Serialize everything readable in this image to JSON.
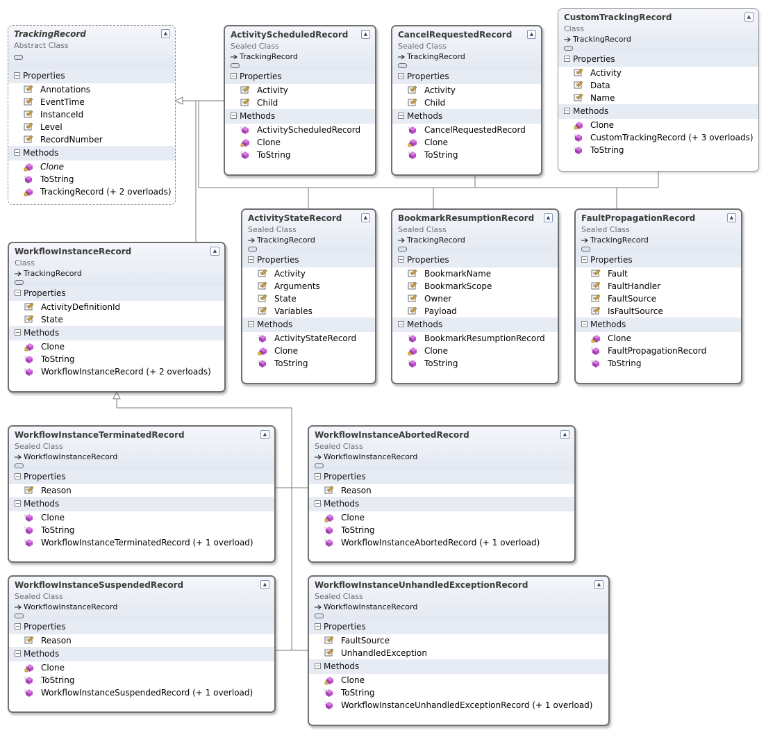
{
  "classes": {
    "tracking_record": {
      "name": "TrackingRecord",
      "stereotype": "Abstract Class",
      "base": "",
      "properties_label": "Properties",
      "methods_label": "Methods",
      "properties": [
        "Annotations",
        "EventTime",
        "InstanceId",
        "Level",
        "RecordNumber"
      ],
      "methods": [
        "Clone",
        "ToString",
        "TrackingRecord (+ 2 overloads)"
      ]
    },
    "activity_scheduled": {
      "name": "ActivityScheduledRecord",
      "stereotype": "Sealed Class",
      "base": "TrackingRecord",
      "properties_label": "Properties",
      "methods_label": "Methods",
      "properties": [
        "Activity",
        "Child"
      ],
      "methods": [
        "ActivityScheduledRecord",
        "Clone",
        "ToString"
      ]
    },
    "cancel_requested": {
      "name": "CancelRequestedRecord",
      "stereotype": "Sealed Class",
      "base": "TrackingRecord",
      "properties_label": "Properties",
      "methods_label": "Methods",
      "properties": [
        "Activity",
        "Child"
      ],
      "methods": [
        "CancelRequestedRecord",
        "Clone",
        "ToString"
      ]
    },
    "custom_tracking": {
      "name": "CustomTrackingRecord",
      "stereotype": "Class",
      "base": "TrackingRecord",
      "properties_label": "Properties",
      "methods_label": "Methods",
      "properties": [
        "Activity",
        "Data",
        "Name"
      ],
      "methods": [
        "Clone",
        "CustomTrackingRecord (+ 3 overloads)",
        "ToString"
      ]
    },
    "workflow_instance": {
      "name": "WorkflowInstanceRecord",
      "stereotype": "Class",
      "base": "TrackingRecord",
      "properties_label": "Properties",
      "methods_label": "Methods",
      "properties": [
        "ActivityDefinitionId",
        "State"
      ],
      "methods": [
        "Clone",
        "ToString",
        "WorkflowInstanceRecord (+ 2 overloads)"
      ]
    },
    "activity_state": {
      "name": "ActivityStateRecord",
      "stereotype": "Sealed Class",
      "base": "TrackingRecord",
      "properties_label": "Properties",
      "methods_label": "Methods",
      "properties": [
        "Activity",
        "Arguments",
        "State",
        "Variables"
      ],
      "methods": [
        "ActivityStateRecord",
        "Clone",
        "ToString"
      ]
    },
    "bookmark_resumption": {
      "name": "BookmarkResumptionRecord",
      "stereotype": "Sealed Class",
      "base": "TrackingRecord",
      "properties_label": "Properties",
      "methods_label": "Methods",
      "properties": [
        "BookmarkName",
        "BookmarkScope",
        "Owner",
        "Payload"
      ],
      "methods": [
        "BookmarkResumptionRecord",
        "Clone",
        "ToString"
      ]
    },
    "fault_propagation": {
      "name": "FaultPropagationRecord",
      "stereotype": "Sealed Class",
      "base": "TrackingRecord",
      "properties_label": "Properties",
      "methods_label": "Methods",
      "properties": [
        "Fault",
        "FaultHandler",
        "FaultSource",
        "IsFaultSource"
      ],
      "methods": [
        "Clone",
        "FaultPropagationRecord",
        "ToString"
      ]
    },
    "wi_terminated": {
      "name": "WorkflowInstanceTerminatedRecord",
      "stereotype": "Sealed Class",
      "base": "WorkflowInstanceRecord",
      "properties_label": "Properties",
      "methods_label": "Methods",
      "properties": [
        "Reason"
      ],
      "methods": [
        "Clone",
        "ToString",
        "WorkflowInstanceTerminatedRecord (+ 1 overload)"
      ]
    },
    "wi_aborted": {
      "name": "WorkflowInstanceAbortedRecord",
      "stereotype": "Sealed Class",
      "base": "WorkflowInstanceRecord",
      "properties_label": "Properties",
      "methods_label": "Methods",
      "properties": [
        "Reason"
      ],
      "methods": [
        "Clone",
        "ToString",
        "WorkflowInstanceAbortedRecord (+ 1 overload)"
      ]
    },
    "wi_suspended": {
      "name": "WorkflowInstanceSuspendedRecord",
      "stereotype": "Sealed Class",
      "base": "WorkflowInstanceRecord",
      "properties_label": "Properties",
      "methods_label": "Methods",
      "properties": [
        "Reason"
      ],
      "methods": [
        "Clone",
        "ToString",
        "WorkflowInstanceSuspendedRecord (+ 1 overload)"
      ]
    },
    "wi_unhandled": {
      "name": "WorkflowInstanceUnhandledExceptionRecord",
      "stereotype": "Sealed Class",
      "base": "WorkflowInstanceRecord",
      "properties_label": "Properties",
      "methods_label": "Methods",
      "properties": [
        "FaultSource",
        "UnhandledException"
      ],
      "methods": [
        "Clone",
        "ToString",
        "WorkflowInstanceUnhandledExceptionRecord (+ 1 overload)"
      ]
    }
  },
  "icons": {
    "property": "property-icon",
    "method": "method-icon",
    "protected_method": "protected-method-icon",
    "base_arrow": "inheritance-arrow-icon",
    "collapse": "collapse-chevron-icon"
  },
  "colors": {
    "member_icon": "#b84fc6",
    "property_icon": "#d9a43a",
    "header_bg": "#e3e8f2",
    "section_bg": "#e7ebf4"
  }
}
